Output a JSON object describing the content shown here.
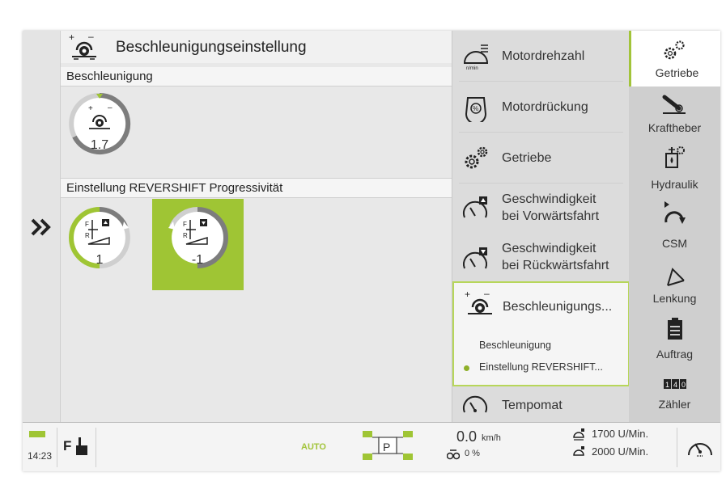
{
  "main": {
    "title": "Beschleunigungseinstellung",
    "section1": "Beschleunigung",
    "dial_acceleration_value": "1.7",
    "section2": "Einstellung REVERSHIFT Progressivität",
    "dial_forward_value": "1",
    "dial_reverse_value": "-1"
  },
  "menu": {
    "items": [
      {
        "label": "Motordrehzahl",
        "icon": "engine-rpm-icon"
      },
      {
        "label": "Motordrückung",
        "icon": "engine-droop-icon"
      },
      {
        "label": "Getriebe",
        "icon": "gears-icon"
      },
      {
        "label_line1": "Geschwindigkeit",
        "label_line2": "bei Vorwärtsfahrt",
        "icon": "speed-forward-icon"
      },
      {
        "label_line1": "Geschwindigkeit",
        "label_line2": "bei Rückwärtsfahrt",
        "icon": "speed-reverse-icon"
      },
      {
        "label": "Beschleunigungs...",
        "icon": "acceleration-icon"
      },
      {
        "label": "Tempomat",
        "icon": "cruise-control-icon"
      }
    ],
    "sub_items": [
      "Beschleunigung",
      "Einstellung REVERSHIFT..."
    ]
  },
  "tabs": [
    "Getriebe",
    "Kraftheber",
    "Hydraulik",
    "CSM",
    "Lenkung",
    "Auftrag",
    "Zähler"
  ],
  "bottom": {
    "time": "14:23",
    "auto_label": "AUTO",
    "gear": "P",
    "speed_value": "0.0",
    "speed_unit": "km/h",
    "slip": "0 %",
    "rpm1": "1700 U/Min.",
    "rpm2": "2000 U/Min."
  },
  "colors": {
    "accent": "#9fc534",
    "dial_ring": "#7d7d7d"
  }
}
